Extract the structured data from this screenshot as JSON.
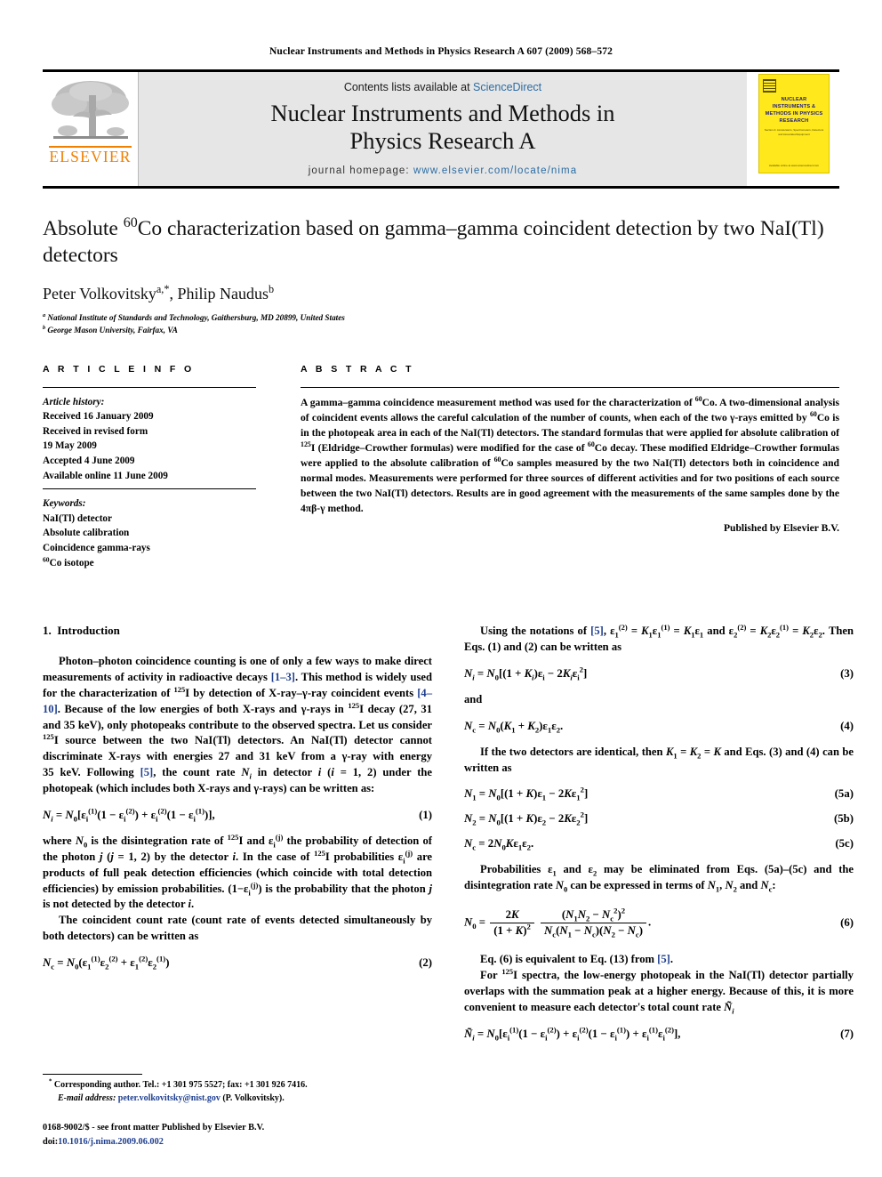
{
  "running_head": "Nuclear Instruments and Methods in Physics Research A 607 (2009) 568–572",
  "masthead": {
    "publisher_name": "ELSEVIER",
    "contents_prefix": "Contents lists available at ",
    "contents_link": "ScienceDirect",
    "journal_title_line1": "Nuclear Instruments and Methods in",
    "journal_title_line2": "Physics Research A",
    "homepage_prefix": "journal homepage: ",
    "homepage_url": "www.elsevier.com/locate/nima",
    "link_color": "#2b6ca3",
    "band_color": "#e6e6e6",
    "cover": {
      "title": "NUCLEAR INSTRUMENTS & METHODS IN PHYSICS RESEARCH",
      "subtitle": "Section A: Accelerators, Spectrometers, Detectors and Associated Equipment",
      "footer": "Available online at www.sciencedirect.com",
      "bg_color": "#ffe81c",
      "title_color": "#1c1a8a"
    }
  },
  "article": {
    "title_part1": "Absolute ",
    "title_sup": "60",
    "title_part2": "Co characterization based on gamma–gamma coincident detection by two NaI(Tl) detectors",
    "authors_a_name": "Peter Volkovitsky",
    "authors_a_marks": "a,*",
    "authors_sep": ", ",
    "authors_b_name": "Philip Naudus",
    "authors_b_marks": "b",
    "affiliation_a_mark": "a",
    "affiliation_a": "National Institute of Standards and Technology, Gaithersburg, MD 20899, United States",
    "affiliation_b_mark": "b",
    "affiliation_b": "George Mason University, Fairfax, VA"
  },
  "article_info": {
    "heading": "A R T I C L E   I N F O",
    "history_label": "Article history:",
    "history": [
      "Received 16 January 2009",
      "Received in revised form",
      "19 May 2009",
      "Accepted 4 June 2009",
      "Available online 11 June 2009"
    ],
    "keywords_label": "Keywords:",
    "keywords": [
      "NaI(Tl) detector",
      "Absolute calibration",
      "Coincidence gamma-rays"
    ],
    "keyword_isotope_sup": "60",
    "keyword_isotope_rest": "Co isotope"
  },
  "abstract": {
    "heading": "A B S T R A C T",
    "text": "A gamma–gamma coincidence measurement method was used for the characterization of 60Co. A two-dimensional analysis of coincident events allows the careful calculation of the number of counts, when each of the two γ-rays emitted by 60Co is in the photopeak area in each of the NaI(Tl) detectors. The standard formulas that were applied for absolute calibration of 125I (Eldridge–Crowther formulas) were modified for the case of 60Co decay. These modified Eldridge–Crowther formulas were applied to the absolute calibration of 60Co samples measured by the two NaI(Tl) detectors both in coincidence and normal modes. Measurements were performed for three sources of different activities and for two positions of each source between the two NaI(Tl) detectors. Results are in good agreement with the measurements of the same samples done by the 4πβ-γ method.",
    "published_by": "Published by Elsevier B.V."
  },
  "left_column": {
    "section_number": "1.",
    "section_title": "Introduction",
    "para1": "Photon–photon coincidence counting is one of only a few ways to make direct measurements of activity in radioactive decays [1–3]. This method is widely used for the characterization of 125I by detection of X-ray–γ-ray coincident events [4–10]. Because of the low energies of both X-rays and γ-rays in 125I decay (27, 31 and 35 keV), only photopeaks contribute to the observed spectra. Let us consider 125I source between the two NaI(Tl) detectors. An NaI(Tl) detector cannot discriminate X-rays with energies 27 and 31 keV from a γ-ray with energy 35 keV. Following [5], the count rate Ni in detector i (i = 1, 2) under the photopeak (which includes both X-rays and γ-rays) can be written as:",
    "eq1_number": "(1)",
    "para2": "where N0 is the disintegration rate of 125I and εi(j) the probability of detection of the photon j (j = 1, 2) by the detector i. In the case of 125I probabilities εi(j) are products of full peak detection efficiencies (which coincide with total detection efficiencies) by emission probabilities. (1−εi(j)) is the probability that the photon j is not detected by the detector i.",
    "para3": "The coincident count rate (count rate of events detected simultaneously by both detectors) can be written as",
    "eq2_number": "(2)"
  },
  "right_column": {
    "para1": "Using the notations of [5], ε1(2) = K1ε1(1) = K1ε1 and ε2(2) = K2ε2(1) = K2ε2. Then Eqs. (1) and (2) can be written as",
    "eq3_number": "(3)",
    "and_text": "and",
    "eq4_number": "(4)",
    "para2": "If the two detectors are identical, then K1 = K2 = K and Eqs. (3) and (4) can be written as",
    "eq5a_number": "(5a)",
    "eq5b_number": "(5b)",
    "eq5c_number": "(5c)",
    "para3": "Probabilities ε1 and ε2 may be eliminated from Eqs. (5a)–(5c) and the disintegration rate N0 can be expressed in terms of N1, N2 and Nc:",
    "eq6_number": "(6)",
    "para4": "Eq. (6) is equivalent to Eq. (13) from [5].",
    "para5": "For 125I spectra, the low-energy photopeak in the NaI(Tl) detector partially overlaps with the summation peak at a higher energy. Because of this, it is more convenient to measure each detector's total count rate Ñi",
    "eq7_number": "(7)"
  },
  "footnote": {
    "star": "*",
    "corresponding": "Corresponding author. Tel.: +1 301 975 5527; fax: +1 301 926 7416.",
    "email_label": "E-mail address:",
    "email": "peter.volkovitsky@nist.gov",
    "email_owner": "(P. Volkovitsky).",
    "issn_line": "0168-9002/$ - see front matter Published by Elsevier B.V.",
    "doi_label": "doi:",
    "doi_value": "10.1016/j.nima.2009.06.002"
  }
}
